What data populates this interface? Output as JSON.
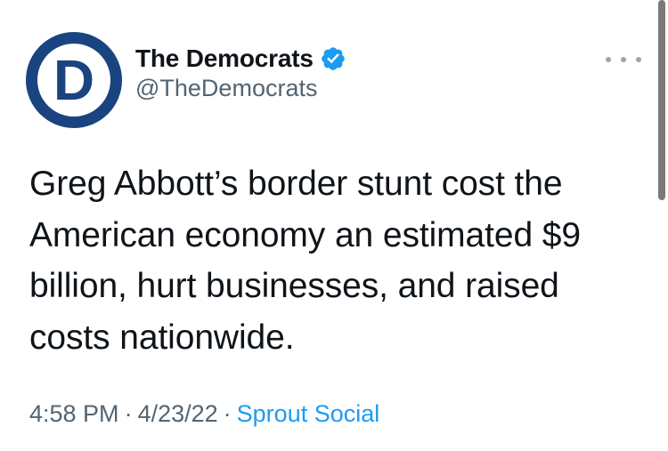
{
  "account": {
    "display_name": "The Democrats",
    "handle": "@TheDemocrats",
    "avatar_letter": "D",
    "verified": true,
    "avatar_color": "#1a4480",
    "verified_color": "#1d9bf0"
  },
  "tweet": {
    "lines": [
      "Greg Abbott’s border stunt cost the",
      "American economy an estimated $9",
      "billion, hurt businesses, and raised",
      "costs nationwide."
    ],
    "time": "4:58 PM",
    "date": "4/23/22",
    "separator": "·",
    "source": "Sprout Social"
  },
  "icons": {
    "more": "more-dots-icon",
    "verified": "verified-badge-icon"
  },
  "colors": {
    "text": "#0f1419",
    "secondary": "#536471",
    "link": "#1d9bf0"
  }
}
